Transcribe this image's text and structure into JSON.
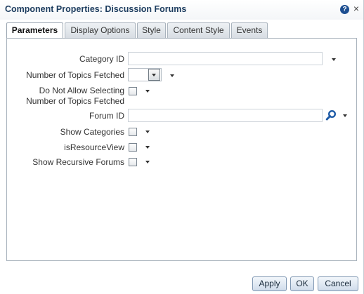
{
  "dialog": {
    "title": "Component Properties: Discussion Forums",
    "help_glyph": "?",
    "close_glyph": "×"
  },
  "tabs": [
    {
      "label": "Parameters",
      "active": true
    },
    {
      "label": "Display Options",
      "active": false
    },
    {
      "label": "Style",
      "active": false
    },
    {
      "label": "Content Style",
      "active": false
    },
    {
      "label": "Events",
      "active": false
    }
  ],
  "fields": {
    "category_id": {
      "label": "Category ID",
      "value": ""
    },
    "num_topics": {
      "label": "Number of Topics Fetched",
      "value": ""
    },
    "do_not_allow": {
      "label_line1": "Do Not Allow Selecting",
      "label_line2": "Number of Topics Fetched",
      "checked": false
    },
    "forum_id": {
      "label": "Forum ID",
      "value": ""
    },
    "show_categories": {
      "label": "Show Categories",
      "checked": false
    },
    "is_resource_view": {
      "label": "isResourceView",
      "checked": false
    },
    "show_recursive": {
      "label": "Show Recursive Forums",
      "checked": false
    }
  },
  "icons": {
    "search": "search-icon",
    "dropdown": "chevron-down-icon",
    "help": "help-icon",
    "close": "close-icon"
  },
  "buttons": {
    "apply": "Apply",
    "ok": "OK",
    "cancel": "Cancel"
  },
  "colors": {
    "title": "#1c3c5e",
    "accent": "#1d4f91",
    "button_border": "#7f97b2"
  }
}
